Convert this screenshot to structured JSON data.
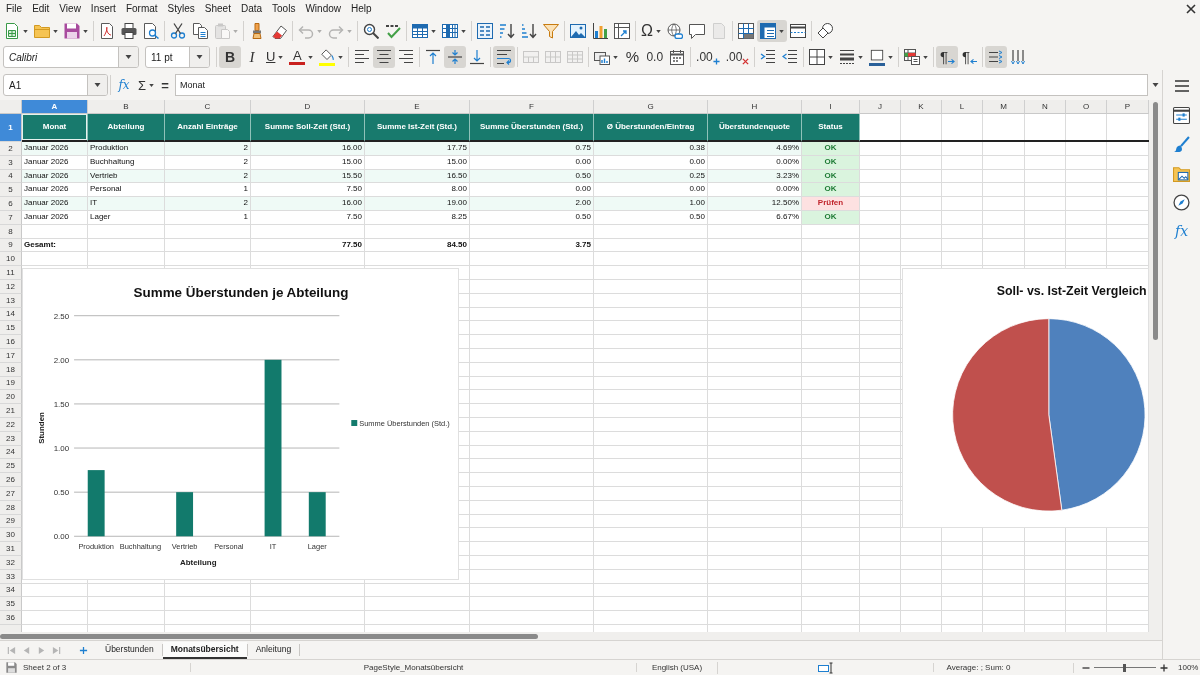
{
  "menu_bar": [
    "File",
    "Edit",
    "View",
    "Insert",
    "Format",
    "Styles",
    "Sheet",
    "Data",
    "Tools",
    "Window",
    "Help"
  ],
  "standard_toolbar": [
    {
      "on": false,
      "disabled": false,
      "dropdown": true
    },
    {
      "on": false,
      "disabled": false,
      "dropdown": true
    },
    {
      "on": false,
      "disabled": false,
      "dropdown": true
    },
    {
      "on": false,
      "disabled": false,
      "dropdown": false
    },
    {
      "on": false,
      "disabled": false,
      "dropdown": false
    },
    {
      "on": false,
      "disabled": false,
      "dropdown": false
    },
    {
      "on": false,
      "disabled": false,
      "dropdown": false
    },
    {
      "on": false,
      "disabled": false,
      "dropdown": false
    },
    {
      "on": false,
      "disabled": true,
      "dropdown": true
    },
    {
      "on": false,
      "disabled": false,
      "dropdown": false
    },
    {
      "on": false,
      "disabled": false,
      "dropdown": false
    },
    {
      "on": false,
      "disabled": true,
      "dropdown": true
    },
    {
      "on": false,
      "disabled": true,
      "dropdown": true
    },
    {
      "on": false,
      "disabled": false,
      "dropdown": false
    },
    {
      "on": false,
      "disabled": false,
      "dropdown": false
    },
    {
      "on": false,
      "disabled": false,
      "dropdown": true
    },
    {
      "on": false,
      "disabled": false,
      "dropdown": true
    },
    {
      "on": false,
      "disabled": false,
      "dropdown": false
    },
    {
      "on": false,
      "disabled": false,
      "dropdown": false
    },
    {
      "on": false,
      "disabled": false,
      "dropdown": false
    },
    {
      "on": false,
      "disabled": false,
      "dropdown": false
    },
    {
      "on": false,
      "disabled": false,
      "dropdown": false
    },
    {
      "on": false,
      "disabled": false,
      "dropdown": false
    },
    {
      "on": false,
      "disabled": false,
      "dropdown": false
    },
    {
      "label": "Ω",
      "on": false,
      "disabled": false,
      "dropdown": true
    },
    {
      "on": false,
      "disabled": false,
      "dropdown": false
    },
    {
      "on": false,
      "disabled": false,
      "dropdown": false
    },
    {
      "on": false,
      "disabled": true,
      "dropdown": false
    },
    {
      "on": false,
      "disabled": false,
      "dropdown": false
    },
    {
      "on": true,
      "disabled": false,
      "dropdown": true
    },
    {
      "on": false,
      "disabled": false,
      "dropdown": false
    },
    {
      "on": false,
      "disabled": false,
      "dropdown": false
    }
  ],
  "formatting_toolbar": {
    "font_name": "Calibri",
    "font_size": "11 pt",
    "buttons": [
      {
        "label": "B",
        "on": true,
        "disabled": false,
        "dropdown": false
      },
      {
        "label": "I",
        "on": false,
        "disabled": false,
        "dropdown": false
      },
      {
        "label": "U",
        "on": false,
        "disabled": false,
        "dropdown": true
      },
      {
        "label": "A",
        "on": false,
        "disabled": false,
        "dropdown": true,
        "color": "#c9211e"
      },
      {
        "on": false,
        "disabled": false,
        "dropdown": true,
        "color": "#ffff00"
      },
      {
        "on": false,
        "disabled": false,
        "dropdown": false
      },
      {
        "on": true,
        "disabled": false,
        "dropdown": false
      },
      {
        "on": false,
        "disabled": false,
        "dropdown": false
      },
      {
        "on": false,
        "disabled": false,
        "dropdown": false
      },
      {
        "on": true,
        "disabled": false,
        "dropdown": false
      },
      {
        "on": false,
        "disabled": false,
        "dropdown": false
      },
      {
        "on": true,
        "disabled": false,
        "dropdown": false
      },
      {
        "on": false,
        "disabled": true,
        "dropdown": false
      },
      {
        "on": false,
        "disabled": true,
        "dropdown": false
      },
      {
        "on": false,
        "disabled": true,
        "dropdown": false
      },
      {
        "on": false,
        "disabled": false,
        "dropdown": true
      },
      {
        "label": "%",
        "on": false,
        "disabled": false,
        "dropdown": false
      },
      {
        "label": "0.0",
        "on": false,
        "disabled": false,
        "dropdown": false
      },
      {
        "on": false,
        "disabled": false,
        "dropdown": false
      },
      {
        "label": ".00",
        "on": false,
        "disabled": false,
        "dropdown": false
      },
      {
        "label": ".00",
        "on": false,
        "disabled": false,
        "dropdown": false
      },
      {
        "on": false,
        "disabled": false,
        "dropdown": false
      },
      {
        "on": false,
        "disabled": false,
        "dropdown": false
      },
      {
        "on": false,
        "disabled": false,
        "dropdown": true
      },
      {
        "on": false,
        "disabled": false,
        "dropdown": true
      },
      {
        "on": false,
        "disabled": false,
        "dropdown": true,
        "color": "#2a6099"
      },
      {
        "on": false,
        "disabled": false,
        "dropdown": true
      },
      {
        "label": "¶",
        "on": true,
        "disabled": false,
        "dropdown": false
      },
      {
        "label": "¶",
        "on": false,
        "disabled": false,
        "dropdown": false
      },
      {
        "on": true,
        "disabled": false,
        "dropdown": false
      },
      {
        "on": false,
        "disabled": false,
        "dropdown": false
      }
    ]
  },
  "formula_bar": {
    "name_box": "A1",
    "function_wizard": "fx",
    "sum": "Σ",
    "formula": "=",
    "content": "Monat"
  },
  "sidebar": {
    "tabs": [
      {
        "selected": false
      },
      {
        "selected": false
      },
      {
        "selected": false
      },
      {
        "selected": false
      },
      {
        "label": "fx",
        "selected": false
      }
    ]
  },
  "sheet": {
    "column_headers": [
      {
        "label": "A",
        "selected": true
      },
      {
        "label": "B",
        "selected": false
      },
      {
        "label": "C",
        "selected": false
      },
      {
        "label": "D",
        "selected": false
      },
      {
        "label": "E",
        "selected": false
      },
      {
        "label": "F",
        "selected": false
      },
      {
        "label": "G",
        "selected": false
      },
      {
        "label": "H",
        "selected": false
      },
      {
        "label": "I",
        "selected": false
      },
      {
        "label": "J",
        "selected": false
      },
      {
        "label": "K",
        "selected": false
      },
      {
        "label": "L",
        "selected": false
      },
      {
        "label": "M",
        "selected": false
      },
      {
        "label": "N",
        "selected": false
      },
      {
        "label": "O",
        "selected": false
      },
      {
        "label": "P",
        "selected": false
      }
    ],
    "row_headers": [
      {
        "label": "1",
        "selected": true
      },
      {
        "label": "2",
        "selected": false
      },
      {
        "label": "3",
        "selected": false
      },
      {
        "label": "4",
        "selected": false
      },
      {
        "label": "5",
        "selected": false
      },
      {
        "label": "6",
        "selected": false
      },
      {
        "label": "7",
        "selected": false
      },
      {
        "label": "8",
        "selected": false
      },
      {
        "label": "9",
        "selected": false
      },
      {
        "label": "10",
        "selected": false
      },
      {
        "label": "11",
        "selected": false
      },
      {
        "label": "12",
        "selected": false
      },
      {
        "label": "13",
        "selected": false
      },
      {
        "label": "14",
        "selected": false
      },
      {
        "label": "15",
        "selected": false
      },
      {
        "label": "16",
        "selected": false
      },
      {
        "label": "17",
        "selected": false
      },
      {
        "label": "18",
        "selected": false
      },
      {
        "label": "19",
        "selected": false
      },
      {
        "label": "20",
        "selected": false
      },
      {
        "label": "21",
        "selected": false
      },
      {
        "label": "22",
        "selected": false
      },
      {
        "label": "23",
        "selected": false
      },
      {
        "label": "24",
        "selected": false
      },
      {
        "label": "25",
        "selected": false
      },
      {
        "label": "26",
        "selected": false
      },
      {
        "label": "27",
        "selected": false
      },
      {
        "label": "28",
        "selected": false
      },
      {
        "label": "29",
        "selected": false
      },
      {
        "label": "30",
        "selected": false
      },
      {
        "label": "31",
        "selected": false
      },
      {
        "label": "32",
        "selected": false
      },
      {
        "label": "33",
        "selected": false
      },
      {
        "label": "34",
        "selected": false
      },
      {
        "label": "35",
        "selected": false
      },
      {
        "label": "36",
        "selected": false
      }
    ],
    "header_row": [
      "Monat",
      "Abteilung",
      "Anzahl Einträge",
      "Summe Soll-Zeit (Std.)",
      "Summe Ist-Zeit (Std.)",
      "Summe Überstunden (Std.)",
      "Ø Überstunden/Eintrag",
      "Überstundenquote",
      "Status"
    ],
    "rows": [
      {
        "shaded": true,
        "cells": [
          "Januar 2026",
          "Produktion",
          "2",
          "16.00",
          "17.75",
          "0.75",
          "0.38",
          "4.69%"
        ],
        "status": {
          "text": "OK",
          "kind": "ok"
        }
      },
      {
        "shaded": false,
        "cells": [
          "Januar 2026",
          "Buchhaltung",
          "2",
          "15.00",
          "15.00",
          "0.00",
          "0.00",
          "0.00%"
        ],
        "status": {
          "text": "OK",
          "kind": "ok"
        }
      },
      {
        "shaded": true,
        "cells": [
          "Januar 2026",
          "Vertrieb",
          "2",
          "15.50",
          "16.50",
          "0.50",
          "0.25",
          "3.23%"
        ],
        "status": {
          "text": "OK",
          "kind": "ok"
        }
      },
      {
        "shaded": false,
        "cells": [
          "Januar 2026",
          "Personal",
          "1",
          "7.50",
          "8.00",
          "0.00",
          "0.00",
          "0.00%"
        ],
        "status": {
          "text": "OK",
          "kind": "ok"
        }
      },
      {
        "shaded": true,
        "cells": [
          "Januar 2026",
          "IT",
          "2",
          "16.00",
          "19.00",
          "2.00",
          "1.00",
          "12.50%"
        ],
        "status": {
          "text": "Prüfen",
          "kind": "check"
        }
      },
      {
        "shaded": false,
        "cells": [
          "Januar 2026",
          "Lager",
          "1",
          "7.50",
          "8.25",
          "0.50",
          "0.50",
          "6.67%"
        ],
        "status": {
          "text": "OK",
          "kind": "ok"
        }
      }
    ],
    "total_row": {
      "label": "Gesamt:",
      "sum_soll": "77.50",
      "sum_ist": "84.50",
      "sum_overtime": "3.75"
    }
  },
  "charts": [
    {
      "chart_data": {
        "type": "bar",
        "title": "Summe Überstunden je Abteilung",
        "xlabel": "Abteilung",
        "ylabel": "Stunden",
        "categories": [
          "Produktion",
          "Buchhaltung",
          "Vertrieb",
          "Personal",
          "IT",
          "Lager"
        ],
        "series": [
          {
            "name": "Summe Überstunden (Std.)",
            "color": "#127a6c",
            "values": [
              0.75,
              0,
              0.5,
              0,
              2,
              0.5
            ]
          }
        ],
        "ylim": [
          0,
          2.5
        ],
        "yticks": [
          {
            "value": 0,
            "label": "0.00"
          },
          {
            "value": 0.5,
            "label": "0.50"
          },
          {
            "value": 1,
            "label": "1.00"
          },
          {
            "value": 1.5,
            "label": "1.50"
          },
          {
            "value": 2,
            "label": "2.00"
          },
          {
            "value": 2.5,
            "label": "2.50"
          }
        ],
        "grid": true
      }
    },
    {
      "chart_data": {
        "type": "pie",
        "title": "Soll- vs. Ist-Zeit Vergleich",
        "values": [
          47.84,
          52.16
        ],
        "colors": [
          "#4f81bd",
          "#c0504d"
        ]
      }
    }
  ],
  "sheet_tabs": {
    "navigation_disabled": true,
    "tabs": [
      {
        "label": "Überstunden",
        "selected": false
      },
      {
        "label": "Monatsübersicht",
        "selected": true
      },
      {
        "label": "Anleitung",
        "selected": false
      }
    ]
  },
  "status_bar": {
    "sheet": "Sheet 2 of 3",
    "page_style": "PageStyle_Monatsübersicht",
    "language": "English (USA)",
    "summary": "Average: ; Sum: 0",
    "zoom_slider": {
      "level": 0.48
    },
    "zoom": "100%"
  }
}
